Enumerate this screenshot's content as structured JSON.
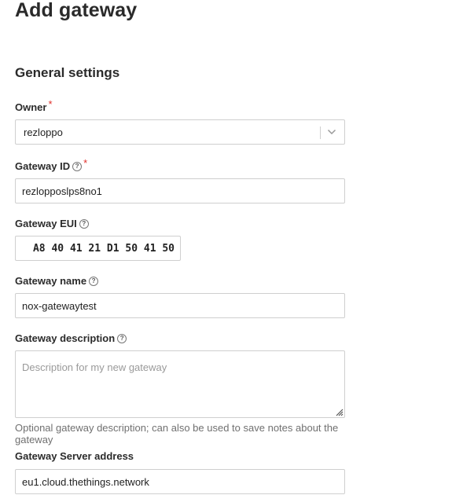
{
  "page": {
    "title": "Add gateway"
  },
  "section": {
    "title": "General settings"
  },
  "owner": {
    "label": "Owner",
    "required_mark": "*",
    "value": "rezloppo"
  },
  "gateway_id": {
    "label": "Gateway ID",
    "required_mark": "*",
    "value": "rezlopposlps8no1"
  },
  "gateway_eui": {
    "label": "Gateway EUI",
    "value": "A8 40 41 21 D1 50 41 50"
  },
  "gateway_name": {
    "label": "Gateway name",
    "value": "nox-gatewaytest"
  },
  "gateway_description": {
    "label": "Gateway description",
    "placeholder": "Description for my new gateway",
    "hint": "Optional gateway description; can also be used to save notes about the gateway"
  },
  "gateway_server_address": {
    "label": "Gateway Server address",
    "value": "eu1.cloud.thethings.network"
  },
  "icons": {
    "help": "help-circle-icon",
    "chevron": "chevron-down-icon",
    "resize": "resize-grip-icon"
  },
  "colors": {
    "required": "#e0302b",
    "border": "#cfcfcf",
    "hint": "#707070"
  }
}
